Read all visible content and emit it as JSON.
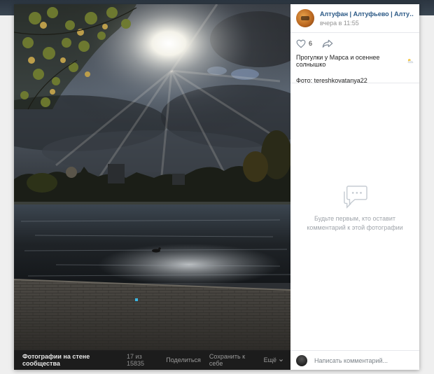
{
  "post": {
    "community_name": "Алтуфан | Алтуфьево | Алтушка | С...",
    "date": "вчера в 11:55",
    "likes": "6",
    "caption": "Прогулки у Марса и осеннее солнышко",
    "author_line": "Фото: tereshkovatanya22"
  },
  "comments": {
    "empty_line1": "Будьте первым, кто оставит",
    "empty_line2": "комментарий к этой фотографии",
    "input_placeholder": "Написать комментарий..."
  },
  "photo_bar": {
    "album": "Фотографии на стене сообщества",
    "counter": "17 из 15835",
    "share": "Поделиться",
    "save": "Сохранить к себе",
    "more": "Ещё"
  },
  "icons": {
    "like": "heart-icon",
    "share": "share-arrow-icon",
    "caption_emoji": "sun-behind-cloud-icon",
    "empty_comments": "comment-bubble-icon",
    "more": "chevron-down-icon"
  },
  "colors": {
    "link": "#2a5885",
    "muted": "#939393",
    "bar_bg": "#1c1c1c"
  }
}
